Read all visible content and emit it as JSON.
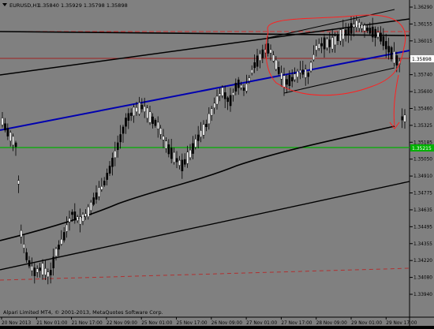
{
  "header": {
    "symbol_menu_icon": "triangle-down-icon",
    "symbol": "EURUSD,H1",
    "ohlc": "1.35840 1.35929 1.35798 1.35898"
  },
  "watermark": "Alpari Limited MT4, © 2001-2013, MetaQuotes Software Corp.",
  "price_labels": [
    "1.36290",
    "1.36155",
    "1.36015",
    "1.35880",
    "1.35740",
    "1.35600",
    "1.35460",
    "1.35325",
    "1.35185",
    "1.35050",
    "1.34910",
    "1.34775",
    "1.34635",
    "1.34495",
    "1.34355",
    "1.34220",
    "1.34080",
    "1.33940"
  ],
  "current_price_label": "1.35898",
  "support_price_label": "1.35215",
  "time_labels": [
    "20 Nov 2013",
    "21 Nov 01:00",
    "21 Nov 17:00",
    "22 Nov 09:00",
    "25 Nov 01:00",
    "25 Nov 17:00",
    "26 Nov 09:00",
    "27 Nov 01:00",
    "27 Nov 17:00",
    "28 Nov 09:00",
    "29 Nov 01:00",
    "29 Nov 17:00"
  ],
  "colors": {
    "background": "#808080",
    "bull_candle": "#000000",
    "bear_candle": "#ffffff",
    "trendline": "#000000",
    "blue_trendline": "#0000b0",
    "support_line": "#00b000",
    "resistance_line": "#c00000",
    "annotation": "#ff2020"
  }
}
